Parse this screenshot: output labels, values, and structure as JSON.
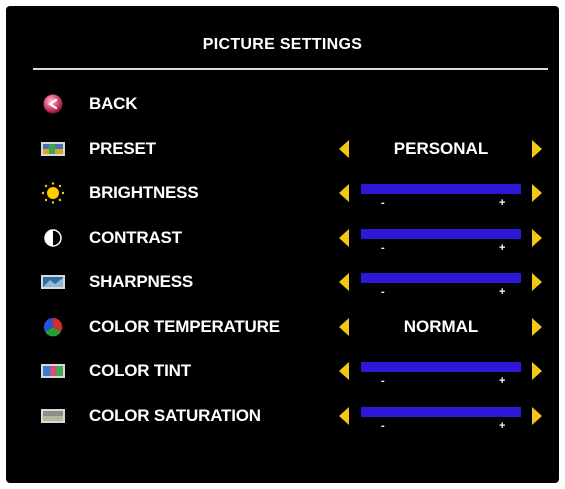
{
  "menu": {
    "title": "PICTURE SETTINGS",
    "accent_arrow_color": "#f3c812",
    "slider_color": "#2c18d6",
    "items": [
      {
        "label": "BACK",
        "icon": "back-icon"
      },
      {
        "label": "PRESET",
        "icon": "preset-icon",
        "value": "PERSONAL"
      },
      {
        "label": "BRIGHTNESS",
        "icon": "brightness-icon",
        "level": 1.0,
        "minus": "-",
        "plus": "+"
      },
      {
        "label": "CONTRAST",
        "icon": "contrast-icon",
        "level": 1.0,
        "minus": "-",
        "plus": "+"
      },
      {
        "label": "SHARPNESS",
        "icon": "sharpness-icon",
        "level": 1.0,
        "minus": "-",
        "plus": "+"
      },
      {
        "label": "COLOR TEMPERATURE",
        "icon": "color-temperature-icon",
        "value": "NORMAL"
      },
      {
        "label": "COLOR TINT",
        "icon": "color-tint-icon",
        "level": 1.0,
        "minus": "-",
        "plus": "+"
      },
      {
        "label": "COLOR SATURATION",
        "icon": "color-saturation-icon",
        "level": 1.0,
        "minus": "-",
        "plus": "+"
      }
    ]
  }
}
